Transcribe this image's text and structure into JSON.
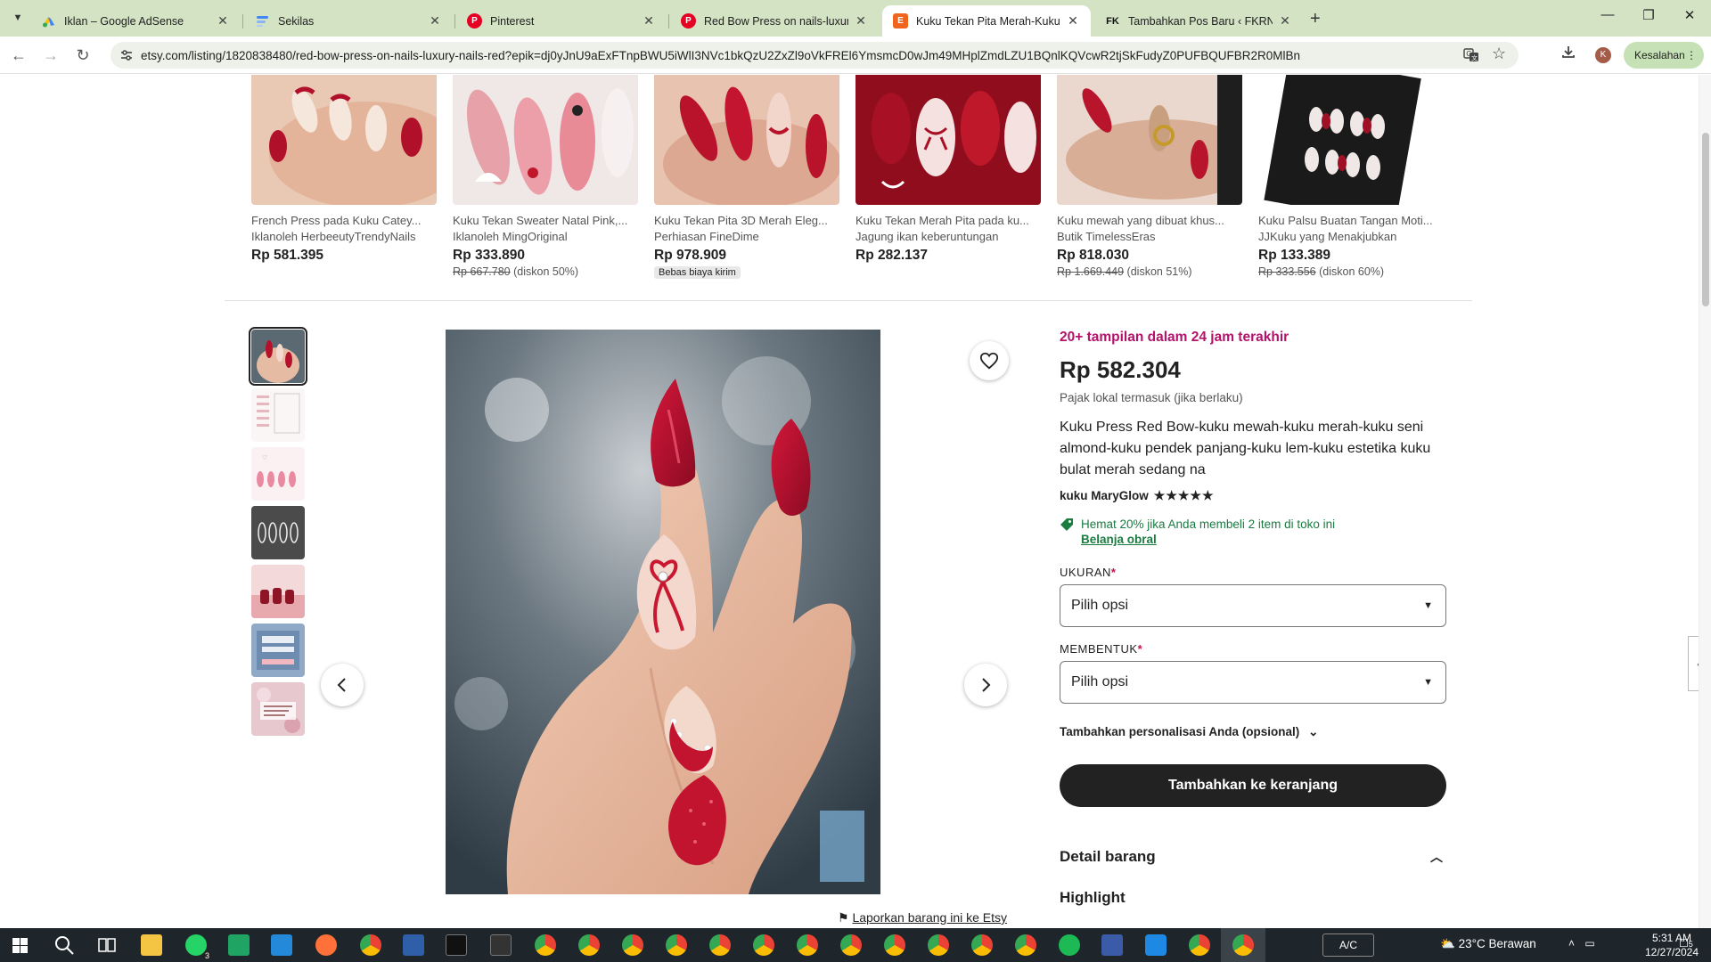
{
  "browser": {
    "tabs": [
      {
        "label": "Iklan – Google AdSense",
        "favicon": "adsense-icon"
      },
      {
        "label": "Sekilas",
        "favicon": "sekilas-icon"
      },
      {
        "label": "Pinterest",
        "favicon": "pinterest-icon"
      },
      {
        "label": "Red Bow Press on nails-luxury n",
        "favicon": "pinterest-icon"
      },
      {
        "label": "Kuku Tekan Pita Merah-Kuku M",
        "favicon": "etsy-icon",
        "active": true
      },
      {
        "label": "Tambahkan Pos Baru ‹ FKRNY –",
        "favicon": "fk-icon"
      }
    ],
    "url": "etsy.com/listing/1820838480/red-bow-press-on-nails-luxury-nails-red?epik=dj0yJnU9aExFTnpBWU5iWlI3NVc1bkQzU2ZxZl9oVkFREl6YmsmcD0wJm49MHplZmdLZU1BQnlKQVcwR2tjSkFudyZ0PUFBQUFBR2R0MlBn",
    "profile_initial": "K",
    "error_chip_label": "Kesalahan"
  },
  "related": [
    {
      "title": "French Press pada Kuku Catey...",
      "shop": "Iklanoleh HerbeeutyTrendyNails",
      "price": "Rp 581.395",
      "orig": "",
      "discount": "",
      "badge": ""
    },
    {
      "title": "Kuku Tekan Sweater Natal Pink,...",
      "shop": "Iklanoleh MingOriginal",
      "price": "Rp 333.890",
      "orig": "Rp 667.780",
      "discount": "(diskon 50%)",
      "badge": ""
    },
    {
      "title": "Kuku Tekan Pita 3D Merah Eleg...",
      "shop": "Perhiasan FineDime",
      "price": "Rp 978.909",
      "orig": "",
      "discount": "",
      "badge": "Bebas biaya kirim"
    },
    {
      "title": "Kuku Tekan Merah Pita pada ku...",
      "shop": "Jagung ikan keberuntungan",
      "price": "Rp 282.137",
      "orig": "",
      "discount": "",
      "badge": ""
    },
    {
      "title": "Kuku mewah yang dibuat khus...",
      "shop": "Butik TimelessEras",
      "price": "Rp 818.030",
      "orig": "Rp 1.669.449",
      "discount": "(diskon 51%)",
      "badge": ""
    },
    {
      "title": "Kuku Palsu Buatan Tangan Moti...",
      "shop": "JJKuku yang Menakjubkan",
      "price": "Rp 133.389",
      "orig": "Rp 333.556",
      "discount": "(diskon 60%)",
      "badge": ""
    }
  ],
  "listing": {
    "views_alert": "20+ tampilan dalam 24 jam terakhir",
    "price": "Rp 582.304",
    "tax_note": "Pajak lokal termasuk (jika berlaku)",
    "title": "Kuku Press Red Bow-kuku mewah-kuku merah-kuku seni almond-kuku pendek panjang-kuku lem-kuku estetika kuku bulat merah sedang na",
    "shop_name": "kuku MaryGlow",
    "rating_stars": 5,
    "promo_text": "Hemat 20% jika Anda membeli 2 item di toko ini",
    "promo_link": "Belanja obral",
    "size_label": "UKURAN",
    "size_value": "Pilih opsi",
    "shape_label": "MEMBENTUK",
    "shape_value": "Pilih opsi",
    "personalize_label": "Tambahkan personalisasi Anda (opsional)",
    "cart_button": "Tambahkan ke keranjang",
    "details_header": "Detail barang",
    "highlight_header": "Highlight",
    "report_link": "Laporkan barang ini ke Etsy",
    "thumbnail_count": 7
  },
  "taskbar": {
    "keyboard_label": "A/C",
    "weather": "23°C  Berawan",
    "time": "5:31 AM",
    "date": "12/27/2024",
    "whatsapp_badge": "3",
    "notification_count": "5"
  },
  "colors": {
    "accent_green": "#1a7c41",
    "alert_magenta": "#b3126a",
    "required_red": "#c3124c",
    "tab_strip": "#d3e3c4"
  }
}
